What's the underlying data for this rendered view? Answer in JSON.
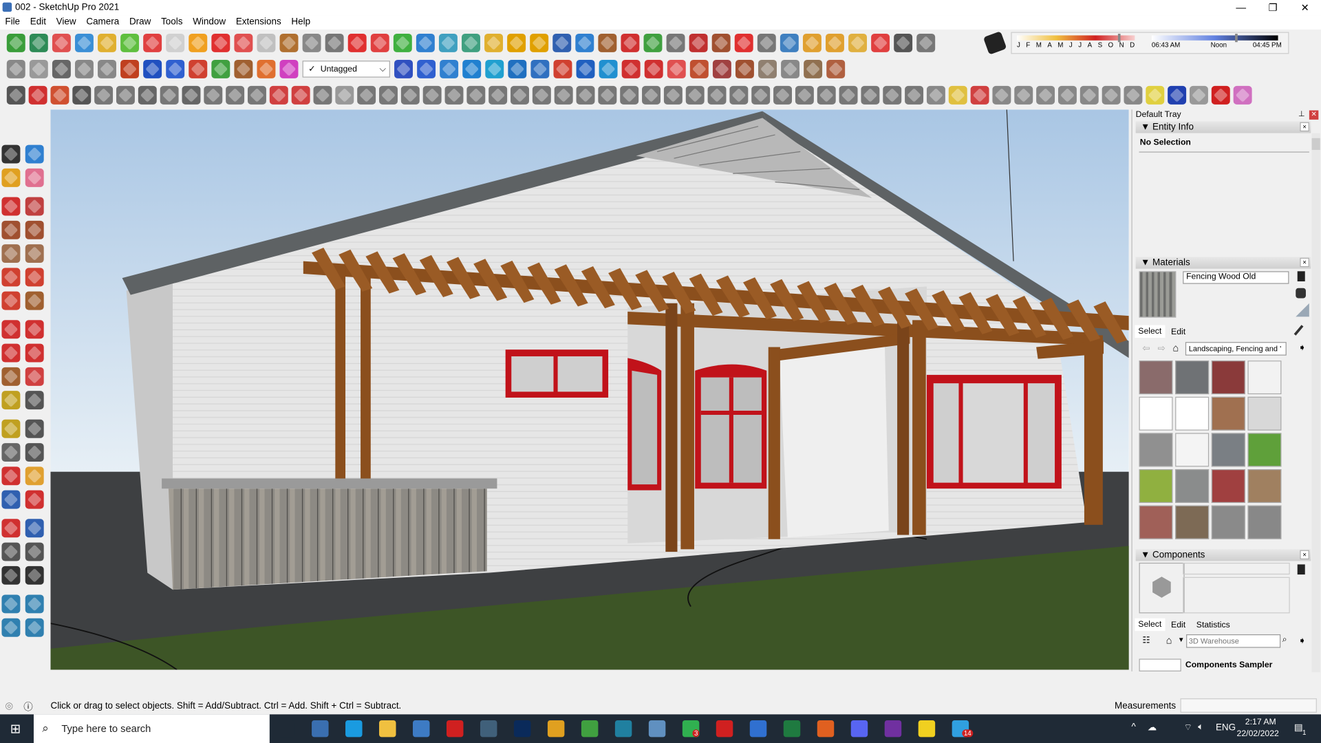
{
  "window": {
    "title": "002 - SketchUp Pro 2021",
    "minimize": "—",
    "maximize": "❐",
    "close": "✕"
  },
  "menu": [
    "File",
    "Edit",
    "View",
    "Camera",
    "Draw",
    "Tools",
    "Window",
    "Extensions",
    "Help"
  ],
  "toolbar": {
    "tag_check": "✓",
    "tag_value": "Untagged",
    "tag_arrow": "⌵",
    "row1_icons": [
      [
        "getting-started-icon",
        "#3a9d3a"
      ],
      [
        "warehouse-icon",
        "#2e8b57"
      ],
      [
        "iso-view-icon",
        "#e05050"
      ],
      [
        "top-view-icon",
        "#3b8fd6"
      ],
      [
        "front-view-icon",
        "#e0b030"
      ],
      [
        "right-view-icon",
        "#5fbf3f"
      ],
      [
        "back-view-icon",
        "#e04040"
      ],
      [
        "left-view-icon",
        "#d0d0d0"
      ],
      [
        "orbit-icon",
        "#f0a020"
      ],
      [
        "section-plane-icon",
        "#e03030"
      ],
      [
        "display-section-icon",
        "#e05050"
      ],
      [
        "flag-icon",
        "#c0c0c0"
      ],
      [
        "box-icon",
        "#b07030"
      ],
      [
        "pipe-icon",
        "#888"
      ],
      [
        "arc-icon",
        "#777"
      ],
      [
        "bezier-icon",
        "#e03030"
      ],
      [
        "move-icon",
        "#e04040"
      ],
      [
        "add-icon",
        "#40b040"
      ],
      [
        "scale-icon",
        "#3080d0"
      ],
      [
        "cone-icon",
        "#40a0c0"
      ],
      [
        "pyramid-icon",
        "#40a080"
      ],
      [
        "triangle-icon",
        "#e0b030"
      ],
      [
        "loop-icon",
        "#e0a000"
      ],
      [
        "lasso-icon",
        "#e0a000"
      ],
      [
        "rotate-icon",
        "#3060b0"
      ],
      [
        "point-icon",
        "#3080d0"
      ],
      [
        "bucket-icon",
        "#a06030"
      ],
      [
        "undo-icon",
        "#d03030"
      ],
      [
        "tree-icon",
        "#40a040"
      ],
      [
        "chain-icon",
        "#777"
      ],
      [
        "joint-icon",
        "#c03030"
      ],
      [
        "hammer-icon",
        "#a05030"
      ],
      [
        "stamp-icon",
        "#e03030"
      ],
      [
        "grid-icon",
        "#777"
      ],
      [
        "layout-icon",
        "#4080c0"
      ],
      [
        "tile-icon",
        "#e0a030"
      ],
      [
        "grid-orange-icon",
        "#e0a030"
      ],
      [
        "grid-yellow-icon",
        "#e0b040"
      ],
      [
        "explode-icon",
        "#e04040"
      ],
      [
        "curve-icon",
        "#555"
      ],
      [
        "dimension-icon",
        "#777"
      ]
    ],
    "row2_icons": [
      [
        "warehouse-share-icon",
        "#888"
      ],
      [
        "building-icon",
        "#999"
      ],
      [
        "house-icon",
        "#666"
      ],
      [
        "house-outline-icon",
        "#888"
      ],
      [
        "garage-icon",
        "#888"
      ],
      [
        "push-icon",
        "#c04020"
      ],
      [
        "solid-blue-icon",
        "#2050c0"
      ],
      [
        "solid-blue2-icon",
        "#3060d0"
      ],
      [
        "solid-red-icon",
        "#d04030"
      ],
      [
        "solid-green-icon",
        "#40a040"
      ],
      [
        "solid-brown-icon",
        "#a06030"
      ],
      [
        "solid-orange-icon",
        "#e07030"
      ],
      [
        "solid-pink-icon",
        "#d040c0"
      ],
      [
        "slash-icon",
        "#3050c0"
      ],
      [
        "slash2-icon",
        "#3060d0"
      ],
      [
        "slash3-icon",
        "#3080d0"
      ],
      [
        "cube-select-icon",
        "#2080d0"
      ],
      [
        "cube2-icon",
        "#20a0d0"
      ],
      [
        "column-icon",
        "#2070c0"
      ],
      [
        "updown-icon",
        "#3070c0"
      ],
      [
        "updown-red-icon",
        "#d04030"
      ],
      [
        "line-arrow-icon",
        "#2060c0"
      ],
      [
        "mirror-icon",
        "#2090d0"
      ],
      [
        "undo2-icon",
        "#d03030"
      ],
      [
        "redo2-icon",
        "#d03030"
      ],
      [
        "hand-icon",
        "#e05050"
      ],
      [
        "shape-icon",
        "#c05030"
      ],
      [
        "mesh-icon",
        "#a04040"
      ],
      [
        "roof-icon",
        "#a05030"
      ],
      [
        "roof2-icon",
        "#908070"
      ],
      [
        "barrel-icon",
        "#888"
      ],
      [
        "panel-icon",
        "#907050"
      ],
      [
        "wedge-icon",
        "#b06040"
      ]
    ],
    "row3_icons": [
      [
        "freehand-icon",
        "#555"
      ],
      [
        "spline-icon",
        "#d03030"
      ],
      [
        "offset-icon",
        "#d05030"
      ],
      [
        "trim-icon",
        "#555"
      ],
      [
        "gear-edit-icon",
        "#777"
      ],
      [
        "follow-icon",
        "#777"
      ],
      [
        "bend-icon",
        "#666"
      ],
      [
        "cut-icon",
        "#777"
      ],
      [
        "shell-icon",
        "#666"
      ],
      [
        "fillet-icon",
        "#777"
      ],
      [
        "chamfer-icon",
        "#777"
      ],
      [
        "corner-icon",
        "#777"
      ],
      [
        "extend-icon",
        "#d04040"
      ],
      [
        "stretch-icon",
        "#d04040"
      ],
      [
        "frame-icon",
        "#777"
      ],
      [
        "wall-icon",
        "#999"
      ],
      [
        "hatch-icon",
        "#777"
      ],
      [
        "stair-icon",
        "#777"
      ],
      [
        "wave-icon",
        "#777"
      ],
      [
        "cylinder-icon",
        "#777"
      ],
      [
        "lathe-icon",
        "#777"
      ],
      [
        "weld-icon",
        "#777"
      ],
      [
        "split-icon",
        "#777"
      ],
      [
        "fan-icon",
        "#777"
      ],
      [
        "blade-icon",
        "#777"
      ],
      [
        "branch-icon",
        "#777"
      ],
      [
        "branch2-icon",
        "#777"
      ],
      [
        "branch3-icon",
        "#777"
      ],
      [
        "gears-icon",
        "#777"
      ],
      [
        "stack-icon",
        "#777"
      ],
      [
        "loft-icon",
        "#777"
      ],
      [
        "loft2-icon",
        "#777"
      ],
      [
        "loft3-icon",
        "#777"
      ],
      [
        "lines-icon",
        "#777"
      ],
      [
        "lines2-icon",
        "#777"
      ],
      [
        "hatch2-icon",
        "#777"
      ],
      [
        "comb-icon",
        "#777"
      ],
      [
        "sphere-icon",
        "#777"
      ],
      [
        "sphere2-icon",
        "#777"
      ],
      [
        "sphere3-icon",
        "#777"
      ],
      [
        "sphere4-icon",
        "#777"
      ],
      [
        "mesh2-icon",
        "#777"
      ],
      [
        "diamond-icon",
        "#888"
      ],
      [
        "tag-icon",
        "#e0c040"
      ],
      [
        "pencil-red-icon",
        "#d04040"
      ],
      [
        "rect-icon",
        "#888"
      ],
      [
        "circle-icon",
        "#888"
      ],
      [
        "polygon-icon",
        "#888"
      ],
      [
        "ellipse-icon",
        "#888"
      ],
      [
        "para-icon",
        "#888"
      ],
      [
        "curve2-icon",
        "#888"
      ],
      [
        "torus-icon",
        "#888"
      ],
      [
        "torus2-icon",
        "#e0d040"
      ],
      [
        "polyline-icon",
        "#2040b0"
      ],
      [
        "lasso2-icon",
        "#999"
      ],
      [
        "line-red-icon",
        "#d02020"
      ],
      [
        "eraser-pink-icon",
        "#d070c0"
      ]
    ]
  },
  "shadow": {
    "months": [
      "J",
      "F",
      "M",
      "A",
      "M",
      "J",
      "J",
      "A",
      "S",
      "O",
      "N",
      "D"
    ],
    "time_start": "06:43 AM",
    "time_mid": "Noon",
    "time_end": "04:45 PM",
    "month_value": 0.86,
    "time_value": 0.66
  },
  "left_toolbar": [
    [
      "select-icon",
      "#333"
    ],
    [
      "component-icon",
      "#3080d0"
    ],
    [
      "paint-bucket-icon",
      "#e0a020"
    ],
    [
      "eraser-icon",
      "#e07090"
    ],
    [
      "line-icon",
      "#d03030"
    ],
    [
      "freehand-icon",
      "#c04040"
    ],
    [
      "rectangle-icon",
      "#a05030"
    ],
    [
      "rotated-rect-icon",
      "#a05030"
    ],
    [
      "circle-icon",
      "#a07050"
    ],
    [
      "polygon-icon",
      "#a07050"
    ],
    [
      "arc-icon",
      "#d04030"
    ],
    [
      "arc2-icon",
      "#d04030"
    ],
    [
      "arc3-icon",
      "#d04030"
    ],
    [
      "pie-icon",
      "#a06030"
    ],
    [
      "move-icon",
      "#d03030"
    ],
    [
      "push-pull-icon",
      "#d03030"
    ],
    [
      "rotate-icon",
      "#d03030"
    ],
    [
      "follow-me-icon",
      "#d03030"
    ],
    [
      "scale-icon",
      "#a06030"
    ],
    [
      "offset-icon",
      "#d04040"
    ],
    [
      "tape-icon",
      "#c0a020"
    ],
    [
      "text-icon",
      "#555"
    ],
    [
      "protractor-icon",
      "#c0a020"
    ],
    [
      "3d-text-icon",
      "#555"
    ],
    [
      "axes-icon",
      "#666"
    ],
    [
      "dimension-icon",
      "#555"
    ],
    [
      "orbit-icon",
      "#d03030"
    ],
    [
      "pan-icon",
      "#e0a030"
    ],
    [
      "zoom-icon",
      "#3060b0"
    ],
    [
      "zoom-window-icon",
      "#d03030"
    ],
    [
      "zoom-extents-icon",
      "#d03030"
    ],
    [
      "previous-view-icon",
      "#3060b0"
    ],
    [
      "position-camera-icon",
      "#555"
    ],
    [
      "look-around-icon",
      "#555"
    ],
    [
      "walk-icon",
      "#333"
    ],
    [
      "section-icon",
      "#333"
    ],
    [
      "sandbox-icon",
      "#3080b0"
    ],
    [
      "sandbox2-icon",
      "#3080b0"
    ],
    [
      "sandbox3-icon",
      "#3080b0"
    ],
    [
      "sandbox4-icon",
      "#3080b0"
    ]
  ],
  "tray": {
    "title": "Default Tray",
    "pin": "⊥",
    "close": "✕",
    "entity_info": {
      "header": "Entity Info",
      "value": "No Selection"
    },
    "materials": {
      "header": "Materials",
      "name": "Fencing Wood Old",
      "tab_select": "Select",
      "tab_edit": "Edit",
      "collection": "Landscaping, Fencing and '",
      "swatches": [
        "#8a6b6b",
        "#6f7275",
        "#8a3a3a",
        "#f2f2f2",
        "#ffffff",
        "#ffffff",
        "#a07050",
        "#d8d8d8",
        "#909090",
        "#f4f4f4",
        "#7a7f84",
        "#5fa03a",
        "#90b040",
        "#8a8c8c",
        "#a04040",
        "#a08060",
        "#a06058",
        "#7d6a55",
        "#8a8a8a",
        "#888888"
      ]
    },
    "components": {
      "header": "Components",
      "tab_select": "Select",
      "tab_edit": "Edit",
      "tab_statistics": "Statistics",
      "search_placeholder": "3D Warehouse",
      "sampler": "Components Sampler"
    }
  },
  "status": {
    "hint": "Click or drag to select objects. Shift = Add/Subtract. Ctrl = Add. Shift + Ctrl = Subtract.",
    "measurements_label": "Measurements",
    "measurements_value": ""
  },
  "taskbar": {
    "search_placeholder": "Type here to search",
    "lang": "ENG",
    "time": "2:17 AM",
    "date": "22/02/2022",
    "notif_count": "1",
    "whatsapp_badge": "3",
    "telegram_badge": "14"
  }
}
